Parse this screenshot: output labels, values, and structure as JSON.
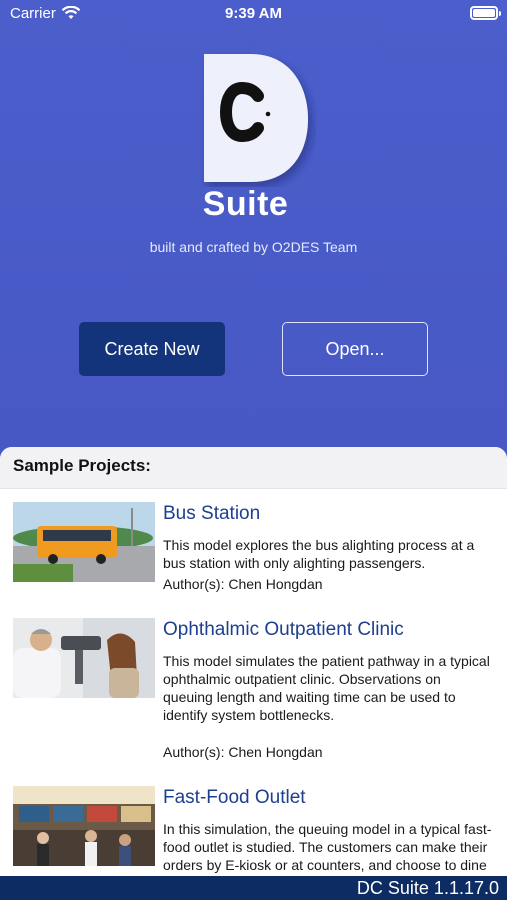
{
  "status_bar": {
    "carrier": "Carrier",
    "time": "9:39 AM"
  },
  "hero": {
    "logo_letter": "C",
    "title": "Suite",
    "tagline": "built and crafted by O2DES Team",
    "create_label": "Create New",
    "open_label": "Open..."
  },
  "samples": {
    "heading": "Sample Projects:",
    "projects": [
      {
        "title": "Bus Station",
        "description": "This model explores the bus alighting process at a bus station with only alighting passengers.",
        "author": "Author(s): Chen Hongdan",
        "image_icon": "bus-photo"
      },
      {
        "title": "Ophthalmic Outpatient Clinic",
        "description": "This model simulates the patient pathway in a typical ophthalmic outpatient clinic. Observations on queuing length and waiting time can be used to identify system bottlenecks.",
        "author": "Author(s): Chen Hongdan",
        "image_icon": "eye-exam-photo"
      },
      {
        "title": "Fast-Food Outlet",
        "description": "In this simulation, the queuing model in a typical fast-food outlet is studied. The customers can make their orders by E-kiosk or at counters, and choose to dine in or take away.",
        "author": "",
        "image_icon": "restaurant-photo"
      }
    ]
  },
  "footer": {
    "version": "DC Suite 1.1.17.0"
  },
  "colors": {
    "hero_bg": "#4a5cc4",
    "primary_button": "#13337a",
    "footer_bg": "#0d2c63",
    "project_title": "#1e3f8f"
  }
}
